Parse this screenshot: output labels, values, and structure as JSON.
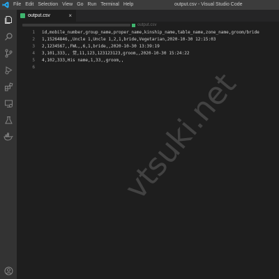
{
  "menu": {
    "items": [
      {
        "id": "file",
        "label": "File"
      },
      {
        "id": "edit",
        "label": "Edit"
      },
      {
        "id": "selection",
        "label": "Selection"
      },
      {
        "id": "view",
        "label": "View"
      },
      {
        "id": "go",
        "label": "Go"
      },
      {
        "id": "run",
        "label": "Run"
      },
      {
        "id": "terminal",
        "label": "Terminal"
      },
      {
        "id": "help",
        "label": "Help"
      }
    ]
  },
  "window_title": "output.csv - Visual Studio Code",
  "tab": {
    "label": "output.csv",
    "close": "×",
    "file_icon": "csv-file-icon"
  },
  "breadcrumb": {
    "file": "output.csv"
  },
  "activity_bar": {
    "icons": [
      "explorer-icon",
      "search-icon",
      "source-control-icon",
      "run-debug-icon",
      "extensions-icon",
      "remote-explorer-icon",
      "testing-icon",
      "docker-icon",
      "account-icon"
    ]
  },
  "editor": {
    "lines": [
      {
        "num": "1",
        "text": "id,mobile_number,group_name,proper_name,kinship_name,table_name,zone_name,groom/bride"
      },
      {
        "num": "2",
        "text": "1,15264846,,Uncle 1,Uncle 1,2,1,bride,Vegetarian,2020-10-30 12:15:03"
      },
      {
        "num": "3",
        "text": "2,1234567,,FWL,,6,1,bride,,2020-10-30 13:39:19"
      },
      {
        "num": "4",
        "text": "3,101,333,, 觉,11,123,123123123,groom,,2020-10-30 15:24:22"
      },
      {
        "num": "5",
        "text": "4,102,333,His name,1,33,,groom,,"
      },
      {
        "num": "6",
        "text": ""
      }
    ]
  },
  "watermark": "vtsuki.net",
  "colors": {
    "accent": "#007acc",
    "editor_bg": "#1e1e1e",
    "activity_bar_bg": "#333333",
    "title_bar_bg": "#3c3c3c",
    "csv_icon": "#3fb56f"
  }
}
